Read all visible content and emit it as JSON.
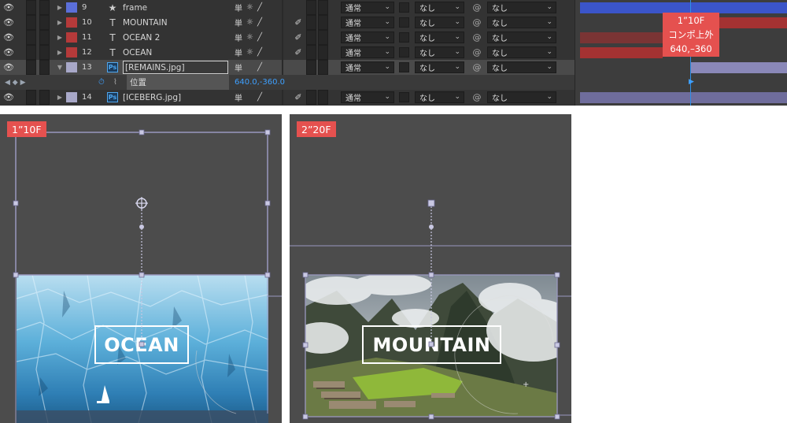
{
  "timeline": {
    "layers": [
      {
        "eye": "👁",
        "index": "9",
        "type": "star",
        "type_glyph": "★",
        "name": "frame",
        "color": "#5b6fd9",
        "mode": "通常",
        "track": "なし",
        "parent": "なし",
        "fx": "none"
      },
      {
        "eye": "👁",
        "index": "10",
        "type": "text",
        "type_glyph": "T",
        "name": "MOUNTAIN",
        "color": "#b53a3a",
        "mode": "通常",
        "track": "なし",
        "parent": "なし",
        "fx": "pen"
      },
      {
        "eye": "👁",
        "index": "11",
        "type": "text",
        "type_glyph": "T",
        "name": "OCEAN 2",
        "color": "#b53a3a",
        "mode": "通常",
        "track": "なし",
        "parent": "なし",
        "fx": "pen"
      },
      {
        "eye": "👁",
        "index": "12",
        "type": "text",
        "type_glyph": "T",
        "name": "OCEAN",
        "color": "#b53a3a",
        "mode": "通常",
        "track": "なし",
        "parent": "なし",
        "fx": "pen"
      },
      {
        "eye": "👁",
        "index": "13",
        "type": "ps",
        "type_glyph": "Ps",
        "name": "[REMAINS.jpg]",
        "color": "#a8a8c8",
        "mode": "通常",
        "track": "なし",
        "parent": "なし",
        "fx": "none"
      },
      {
        "eye": "👁",
        "index": "14",
        "type": "ps",
        "type_glyph": "Ps",
        "name": "[ICEBERG.jpg]",
        "color": "#a8a8c8",
        "mode": "通常",
        "track": "なし",
        "parent": "なし",
        "fx": "pen"
      }
    ],
    "property": {
      "name": "位置",
      "value": "640.0,-360.0"
    },
    "switch_glyphs": {
      "shy": "単",
      "collapse": "☼",
      "quality": "╱"
    },
    "fx_glyph": "✐",
    "parent_glyph": "@",
    "chevron": "⌄",
    "expand_open": "▼",
    "expand_closed": "▶"
  },
  "callout": {
    "line1": "1”10F",
    "line2": "コンポ上外",
    "line3": "640,–360"
  },
  "viewer_left": {
    "time": "1”10F",
    "title": "OCEAN"
  },
  "viewer_right": {
    "time": "2”20F",
    "title": "MOUNTAIN"
  },
  "colors": {
    "accent": "#e5514f",
    "marker": "#2f8fe8",
    "bar_blue": "#3b55c9",
    "bar_red": "#a43232",
    "bar_lav": "#8a88b8",
    "bar_gray": "#6f6d9c"
  }
}
